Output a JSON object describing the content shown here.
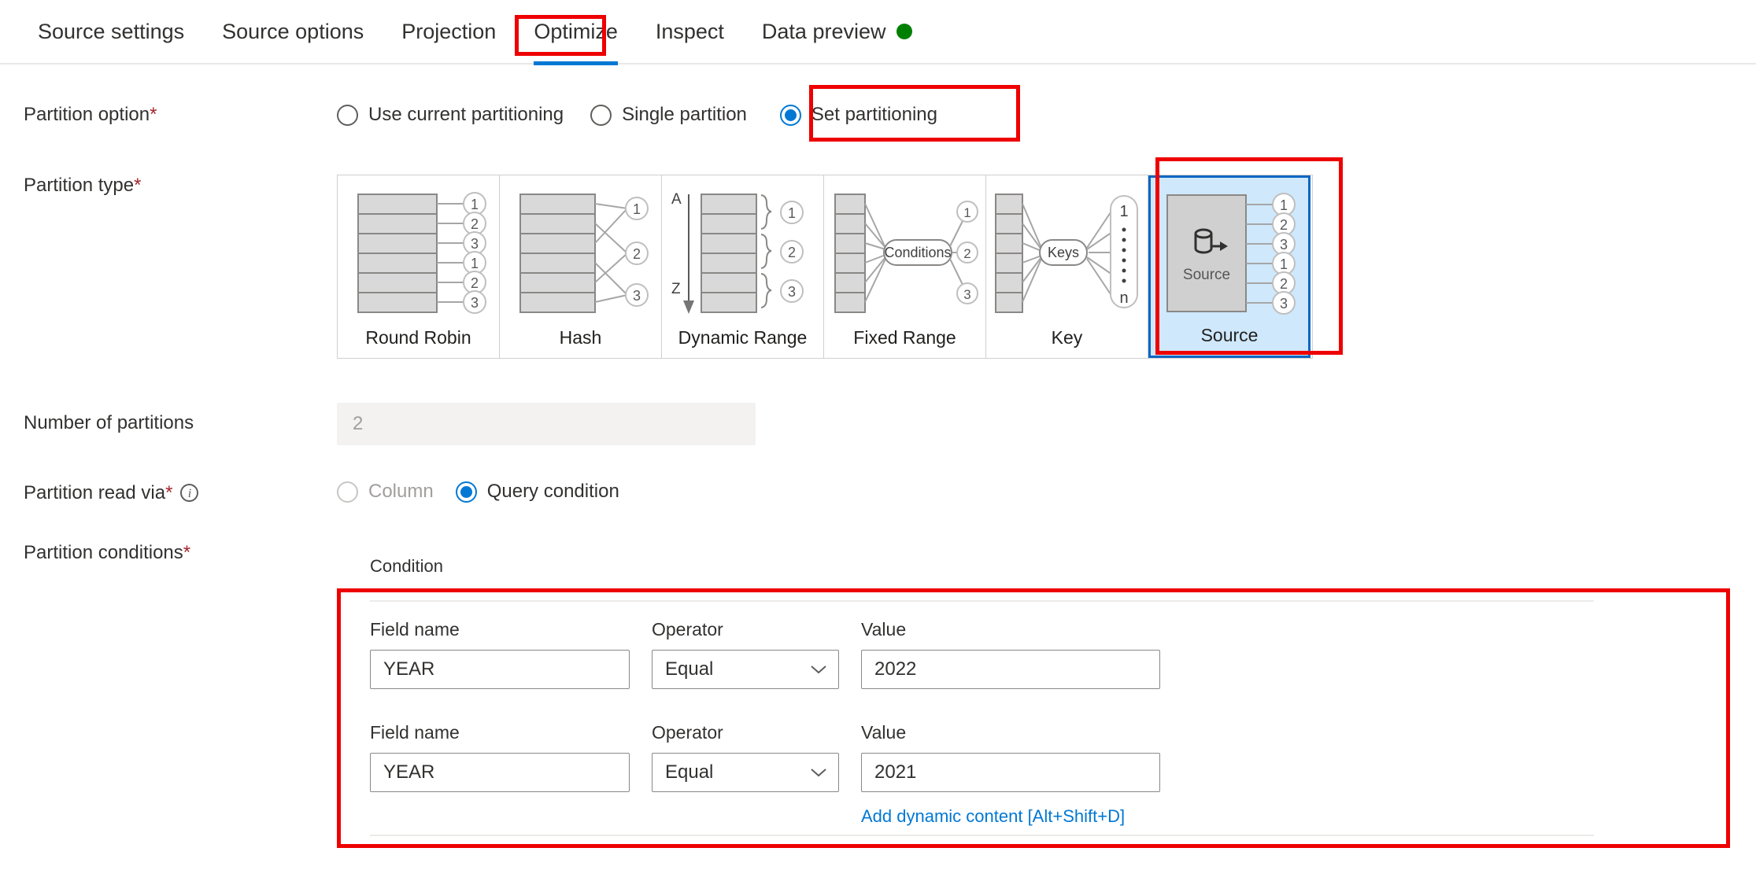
{
  "tabs": [
    {
      "label": "Source settings",
      "active": false
    },
    {
      "label": "Source options",
      "active": false
    },
    {
      "label": "Projection",
      "active": false
    },
    {
      "label": "Optimize",
      "active": true
    },
    {
      "label": "Inspect",
      "active": false
    },
    {
      "label": "Data preview",
      "active": false,
      "status_dot": "#008000"
    }
  ],
  "form": {
    "partition_option": {
      "label": "Partition option",
      "required": "*",
      "options": [
        {
          "label": "Use current partitioning",
          "selected": false
        },
        {
          "label": "Single partition",
          "selected": false
        },
        {
          "label": "Set partitioning",
          "selected": true
        }
      ]
    },
    "partition_type": {
      "label": "Partition type",
      "required": "*",
      "tiles": [
        {
          "label": "Round Robin",
          "selected": false
        },
        {
          "label": "Hash",
          "selected": false
        },
        {
          "label": "Dynamic Range",
          "selected": false,
          "axis_top": "A",
          "axis_bottom": "Z"
        },
        {
          "label": "Fixed Range",
          "selected": false,
          "node": "Conditions"
        },
        {
          "label": "Key",
          "selected": false,
          "node": "Keys",
          "out_top": "1",
          "out_bottom": "n"
        },
        {
          "label": "Source",
          "selected": true,
          "node": "Source"
        }
      ],
      "round_robin_outputs": [
        "1",
        "2",
        "3",
        "1",
        "2",
        "3"
      ],
      "hash_outputs": [
        "1",
        "2",
        "3"
      ],
      "dynamic_range_outputs": [
        "1",
        "2",
        "3"
      ],
      "fixed_range_outputs": [
        "1",
        "2",
        "3"
      ],
      "source_outputs": [
        "1",
        "2",
        "3",
        "1",
        "2",
        "3"
      ]
    },
    "number_of_partitions": {
      "label": "Number of partitions",
      "value": "2",
      "disabled": true
    },
    "partition_read_via": {
      "label": "Partition read via",
      "required": "*",
      "info": "i",
      "options": [
        {
          "label": "Column",
          "selected": false,
          "disabled": true
        },
        {
          "label": "Query condition",
          "selected": true,
          "disabled": false
        }
      ]
    },
    "partition_conditions": {
      "label": "Partition conditions",
      "required": "*",
      "section_header": "Condition",
      "columns": {
        "field_name": "Field name",
        "operator": "Operator",
        "value": "Value"
      },
      "rows": [
        {
          "field_name": "YEAR",
          "operator": "Equal",
          "value": "2022"
        },
        {
          "field_name": "YEAR",
          "operator": "Equal",
          "value": "2021"
        }
      ],
      "dynamic_content_link": "Add dynamic content [Alt+Shift+D]"
    }
  },
  "annotations": {
    "highlight_color": "#ee0000",
    "boxes": [
      "optimize-tab",
      "set-partitioning-radio",
      "source-partition-tile",
      "partition-conditions-area"
    ]
  }
}
